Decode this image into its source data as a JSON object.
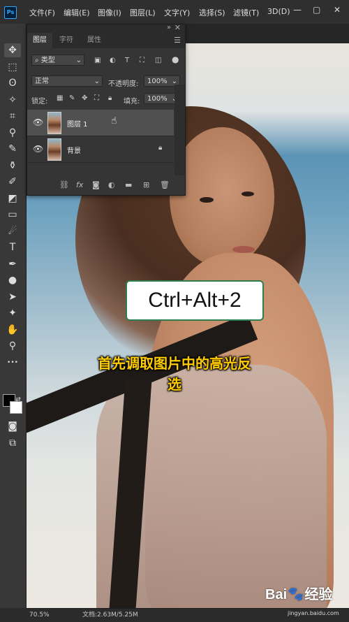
{
  "app": {
    "logo": "Ps"
  },
  "menu": [
    "文件(F)",
    "编辑(E)",
    "图像(I)",
    "图层(L)",
    "文字(Y)",
    "选择(S)",
    "滤镜(T)",
    "3D(D)"
  ],
  "window_controls": {
    "minimize": "—",
    "restore": "▢",
    "close": "✕"
  },
  "tools": [
    {
      "name": "move-tool-icon",
      "glyph": "✥",
      "active": true
    },
    {
      "name": "marquee-tool-icon",
      "glyph": "⬚"
    },
    {
      "name": "lasso-tool-icon",
      "glyph": "ʘ"
    },
    {
      "name": "magic-wand-tool-icon",
      "glyph": "✧"
    },
    {
      "name": "crop-tool-icon",
      "glyph": "⌗"
    },
    {
      "name": "eyedropper-tool-icon",
      "glyph": "⚲"
    },
    {
      "name": "brush-tool-icon",
      "glyph": "✎"
    },
    {
      "name": "stamp-tool-icon",
      "glyph": "⚱"
    },
    {
      "name": "history-brush-tool-icon",
      "glyph": "✐"
    },
    {
      "name": "eraser-tool-icon",
      "glyph": "◩"
    },
    {
      "name": "gradient-tool-icon",
      "glyph": "▭"
    },
    {
      "name": "smudge-tool-icon",
      "glyph": "☄"
    },
    {
      "name": "type-tool-icon",
      "glyph": "T"
    },
    {
      "name": "pen-tool-icon",
      "glyph": "✒"
    },
    {
      "name": "dodge-tool-icon",
      "glyph": "●"
    },
    {
      "name": "path-selection-tool-icon",
      "glyph": "➤"
    },
    {
      "name": "shape-tool-icon",
      "glyph": "✦"
    },
    {
      "name": "hand-tool-icon",
      "glyph": "✋"
    },
    {
      "name": "zoom-tool-icon",
      "glyph": "⚲"
    },
    {
      "name": "more-tools-icon",
      "glyph": "•••"
    }
  ],
  "layers_panel": {
    "tabs": [
      "图层",
      "字符",
      "属性"
    ],
    "active_tab": 0,
    "filter_kind": "类型",
    "blend_mode": "正常",
    "opacity_label": "不透明度:",
    "opacity_value": "100%",
    "lock_label": "锁定:",
    "fill_label": "填充:",
    "fill_value": "100%",
    "layers": [
      {
        "name": "图层 1",
        "visible": true,
        "selected": true,
        "locked": false
      },
      {
        "name": "背景",
        "visible": true,
        "selected": false,
        "locked": true
      }
    ],
    "footer_icons": [
      "link-layers-icon",
      "fx-icon",
      "layer-mask-icon",
      "adjustment-layer-icon",
      "group-folder-icon",
      "new-layer-icon",
      "delete-layer-icon"
    ]
  },
  "overlay": {
    "shortcut": "Ctrl+Alt+2",
    "caption_line1": "首先调取图片中的高光反",
    "caption_line2": "选"
  },
  "status": {
    "zoom": "70.5%",
    "doc": "文档:2.63M/5.25M"
  },
  "watermark": {
    "brand": "Bai",
    "brand2": "经验",
    "url": "jingyan.baidu.com"
  },
  "colors": {
    "accent": "#31a8ff",
    "caption": "#ffcc00",
    "shortcut_border": "#2e7d4f"
  }
}
